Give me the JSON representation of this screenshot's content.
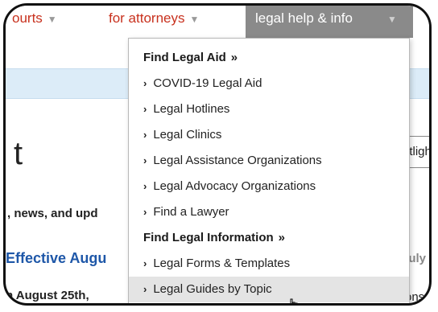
{
  "nav": {
    "items": [
      {
        "label": "ourts",
        "id": "courts"
      },
      {
        "label": "for attorneys",
        "id": "attorneys"
      }
    ],
    "active": {
      "label": "legal help & info"
    }
  },
  "page": {
    "spotlight_label": "otligh",
    "news_text": ", news, and upd",
    "effective_text": "Effective Augu",
    "july_text": "July",
    "aug25_text": "n August 25th,",
    "ons_text": "ons"
  },
  "dropdown": {
    "find_legal_aid": "Find Legal Aid",
    "aid_links": [
      "COVID-19 Legal Aid",
      "Legal Hotlines",
      "Legal Clinics",
      "Legal Assistance Organizations",
      "Legal Advocacy Organizations",
      "Find a Lawyer"
    ],
    "find_legal_information": "Find Legal Information",
    "info_links": [
      "Legal Forms & Templates",
      "Legal Guides by Topic"
    ],
    "section_arrow": "»",
    "link_arrow": "›"
  }
}
